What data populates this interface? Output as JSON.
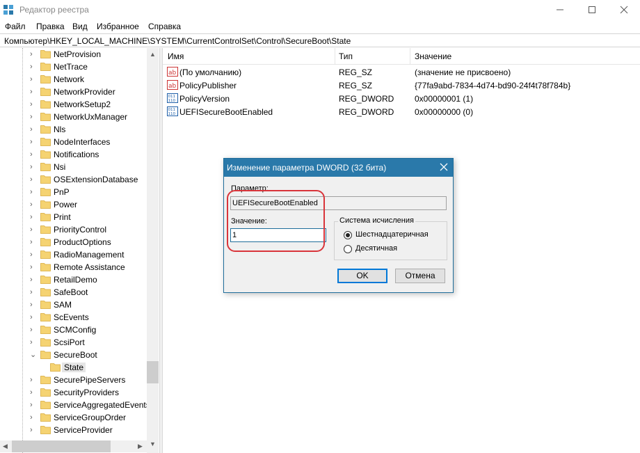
{
  "window": {
    "title": "Редактор реестра"
  },
  "menu": [
    "Файл",
    "Правка",
    "Вид",
    "Избранное",
    "Справка"
  ],
  "address": "Компьютер\\HKEY_LOCAL_MACHINE\\SYSTEM\\CurrentControlSet\\Control\\SecureBoot\\State",
  "tree": {
    "items": [
      "NetProvision",
      "NetTrace",
      "Network",
      "NetworkProvider",
      "NetworkSetup2",
      "NetworkUxManager",
      "Nls",
      "NodeInterfaces",
      "Notifications",
      "Nsi",
      "OSExtensionDatabase",
      "PnP",
      "Power",
      "Print",
      "PriorityControl",
      "ProductOptions",
      "RadioManagement",
      "Remote Assistance",
      "RetailDemo",
      "SafeBoot",
      "SAM",
      "ScEvents",
      "SCMConfig",
      "ScsiPort",
      "SecureBoot"
    ],
    "expanded_label": "SecureBoot",
    "child": "State",
    "items_after": [
      "SecurePipeServers",
      "SecurityProviders",
      "ServiceAggregatedEvents",
      "ServiceGroupOrder",
      "ServiceProvider"
    ]
  },
  "list": {
    "columns": [
      "Имя",
      "Тип",
      "Значение"
    ],
    "rows": [
      {
        "name": "(По умолчанию)",
        "type": "REG_SZ",
        "value": "(значение не присвоено)",
        "icon": "string-value-icon"
      },
      {
        "name": "PolicyPublisher",
        "type": "REG_SZ",
        "value": "{77fa9abd-7834-4d74-bd90-24f4t78f784b}",
        "icon": "string-value-icon"
      },
      {
        "name": "PolicyVersion",
        "type": "REG_DWORD",
        "value": "0x00000001 (1)",
        "icon": "dword-value-icon"
      },
      {
        "name": "UEFISecureBootEnabled",
        "type": "REG_DWORD",
        "value": "0x00000000 (0)",
        "icon": "dword-value-icon"
      }
    ]
  },
  "dialog": {
    "title": "Изменение параметра DWORD (32 бита)",
    "param_label": "Параметр:",
    "param_value": "UEFISecureBootEnabled",
    "value_label": "Значение:",
    "value": "1",
    "base_group": "Система исчисления",
    "radio_hex": "Шестнадцатеричная",
    "radio_dec": "Десятичная",
    "selected_base": "hex",
    "ok": "OK",
    "cancel": "Отмена"
  },
  "colors": {
    "dialog_titlebar": "#2a79aa",
    "annotation": "#d9343a",
    "folder": "#f5d372"
  }
}
